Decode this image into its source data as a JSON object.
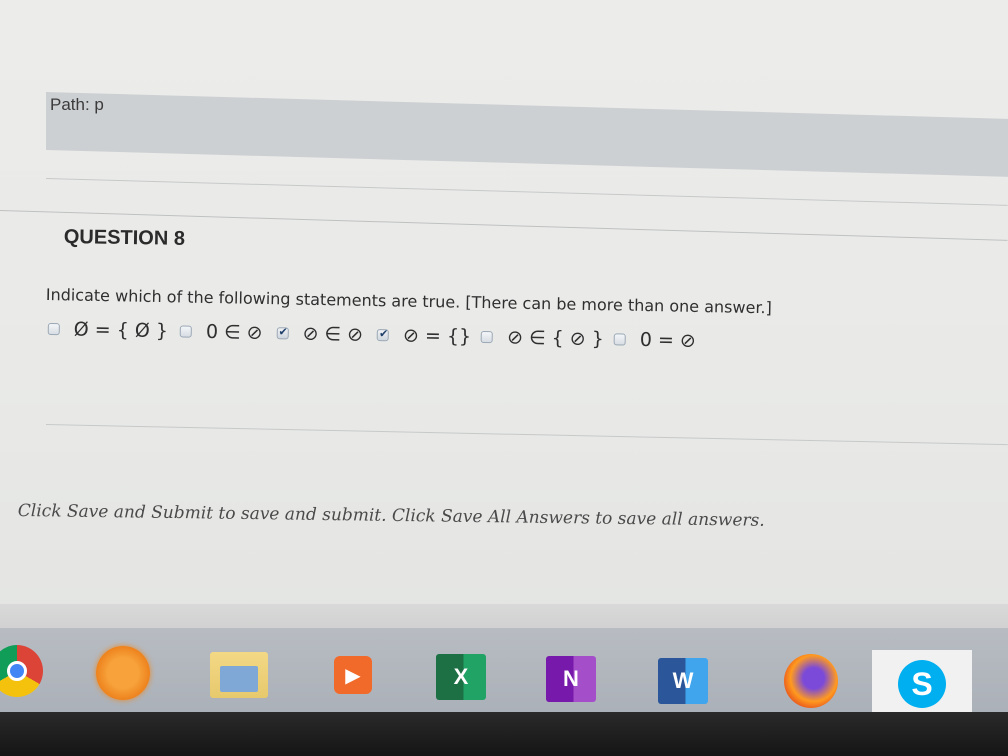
{
  "path": {
    "label": "Path: p"
  },
  "question": {
    "title": "QUESTION 8",
    "text": "Indicate which of the following statements are true. [There can be more than one answer.]",
    "options": [
      {
        "label": "Ø = { Ø }",
        "checked": false
      },
      {
        "label": "0 ∈ ⊘",
        "checked": false
      },
      {
        "label": "⊘ ∈ ⊘",
        "checked": true
      },
      {
        "label": "⊘ = {}",
        "checked": true
      },
      {
        "label": "⊘ ∈ { ⊘ }",
        "checked": false
      },
      {
        "label": "0 = ⊘",
        "checked": false
      }
    ]
  },
  "instructions": "Click Save and Submit to save and submit. Click Save All Answers to save all answers.",
  "taskbar": {
    "excel_letter": "X",
    "onenote_letter": "N",
    "word_letter": "W",
    "skype_letter": "S",
    "media_glyph": "▶"
  }
}
